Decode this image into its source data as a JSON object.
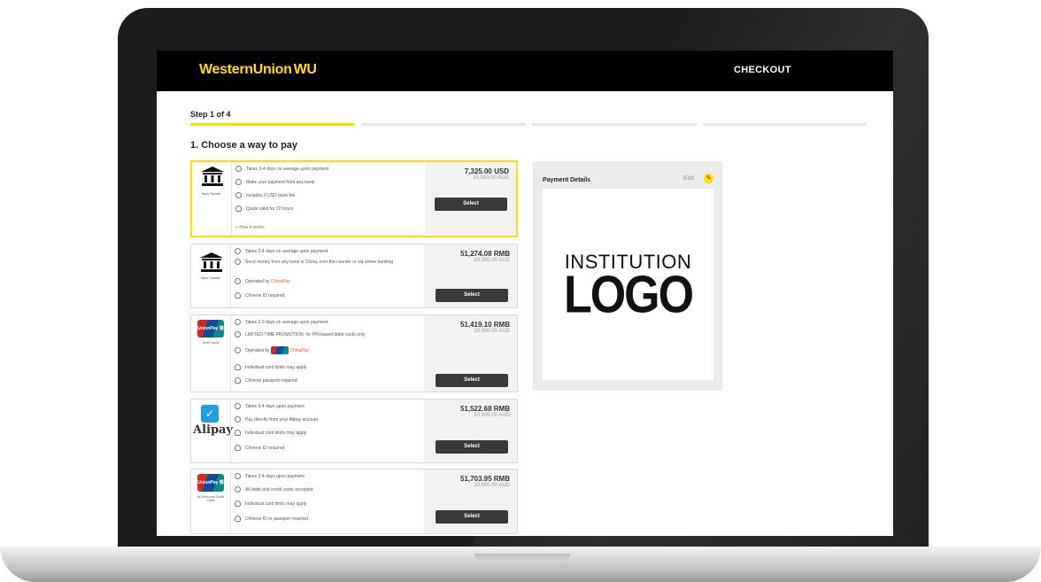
{
  "header": {
    "brand": "WesternUnion",
    "brand_mark": "WU",
    "checkout": "CHECKOUT"
  },
  "progress": {
    "label": "Step 1 of 4",
    "current_step": 1,
    "total_steps": 4
  },
  "section_title": "1. Choose a way to pay",
  "colors": {
    "brand_yellow": "#ffdd00",
    "header_bg": "#000000",
    "button_bg": "#3a3a3a"
  },
  "options": [
    {
      "logo": "bank-icon",
      "caption": "Bank Transfer",
      "features": [
        {
          "icon": "clock-icon",
          "text": "Takes 3-4 days on average upon payment"
        },
        {
          "icon": "check-icon",
          "text": "Make your payment from any bank"
        },
        {
          "icon": "check-icon",
          "text": "Includes 0 USD bank fee"
        },
        {
          "icon": "bulb-icon",
          "text": "Quote valid for 72 hours"
        }
      ],
      "how_it_works": "How it works",
      "price": "7,325.00 USD",
      "amount": "10,000.00 AUD",
      "select_label": "Select"
    },
    {
      "logo": "bank-icon",
      "caption": "Bank Transfer",
      "features": [
        {
          "icon": "clock-icon",
          "text": "Takes 2-4 days on average upon payment"
        },
        {
          "icon": "check-icon",
          "text": "Send money from any bank in China, over the counter or via online banking"
        },
        {
          "icon": "check-icon",
          "text": "Operated by"
        },
        {
          "icon": "bulb-icon",
          "text": "Chinese ID required"
        }
      ],
      "operator": "ChinaPay",
      "price": "51,274.08 RMB",
      "amount": "10,000.00 AUD",
      "select_label": "Select"
    },
    {
      "logo": "unionpay-icon",
      "logo_text": "UnionPay 银联",
      "caption": "Debit Cards",
      "features": [
        {
          "icon": "clock-icon",
          "text": "Takes 2-3 days on average upon payment"
        },
        {
          "icon": "check-icon",
          "text": "LIMITED-TIME PROMOTION: for PIN based debit cards only"
        },
        {
          "icon": "check-icon",
          "text": "Operated by"
        },
        {
          "icon": "bulb-icon",
          "text": "Individual card limits may apply"
        },
        {
          "icon": "bulb-icon",
          "text": "Chinese passport required"
        }
      ],
      "operator": "ChinaPay",
      "price": "51,419.10 RMB",
      "amount": "10,000.00 AUD",
      "select_label": "Select"
    },
    {
      "logo": "alipay-icon",
      "logo_text": "Alipay",
      "features": [
        {
          "icon": "clock-icon",
          "text": "Takes 3-4 days upon payment"
        },
        {
          "icon": "check-icon",
          "text": "Pay directly from your Alipay account"
        },
        {
          "icon": "bulb-icon",
          "text": "Individual card limits may apply"
        },
        {
          "icon": "bulb-icon",
          "text": "Chinese ID required"
        }
      ],
      "price": "51,522.68 RMB",
      "amount": "10,000.00 AUD",
      "select_label": "Select"
    },
    {
      "logo": "unionpay-icon",
      "logo_text": "UnionPay 银联",
      "caption": "All Debit and Credit Cards",
      "features": [
        {
          "icon": "clock-icon",
          "text": "Takes 2-4 days upon payment"
        },
        {
          "icon": "check-icon",
          "text": "All debit and credit cards accepted"
        },
        {
          "icon": "bulb-icon",
          "text": "Individual card limits may apply"
        },
        {
          "icon": "bulb-icon",
          "text": "Chinese ID or passport required"
        }
      ],
      "price": "51,703.95 RMB",
      "amount": "10,000.00 AUD",
      "select_label": "Select"
    }
  ],
  "payment_details": {
    "title": "Payment Details",
    "edit": "Edit",
    "logo_line1": "INSTITUTION",
    "logo_line2": "LOGO"
  }
}
